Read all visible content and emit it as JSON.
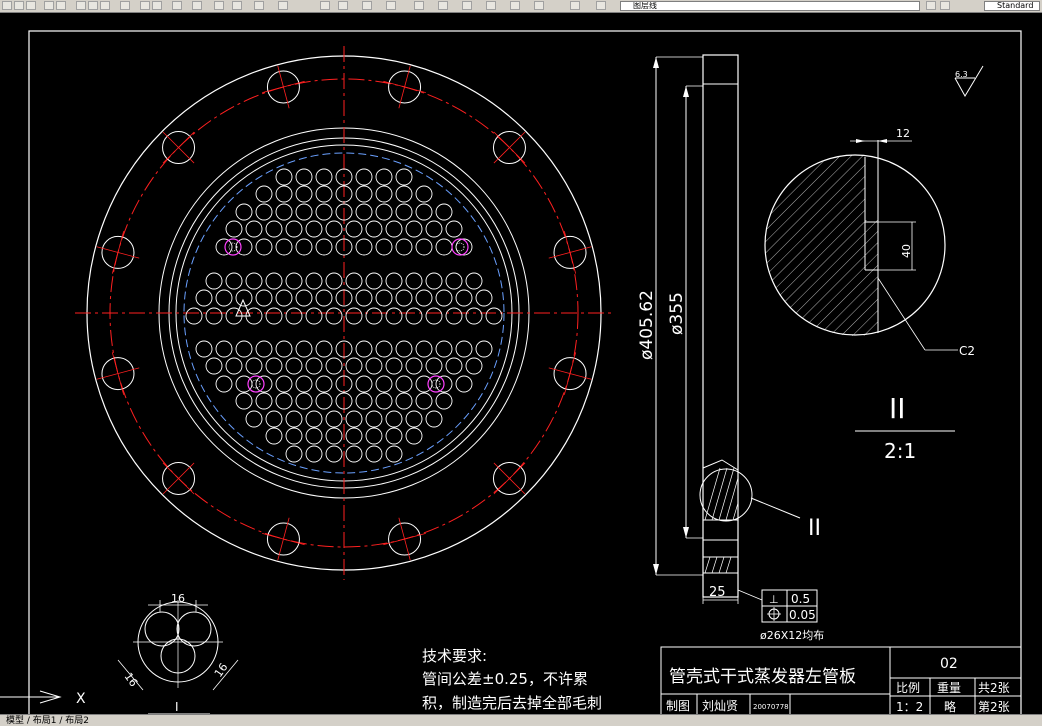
{
  "toolbar": {
    "layer_combo": "图层线",
    "font_combo": "Standard",
    "buttons": [
      "new",
      "open",
      "save",
      "print",
      "preview",
      "cut",
      "copy",
      "paste",
      "match",
      "undo",
      "redo",
      "pan",
      "zoom-realtime",
      "zoom-window",
      "zoom-previous",
      "properties",
      "designcenter",
      "tool-palettes",
      "markup",
      "calculator",
      "layer-properties"
    ]
  },
  "drawing": {
    "dim_diameter_outer": "ø405.62",
    "dim_diameter_inner": "ø355",
    "dim_thickness": "25",
    "dim_12": "12",
    "dim_40": "40",
    "chamfer": "C2",
    "roughness": "6.3",
    "detail_label": "II",
    "detail_scale": "2:1",
    "detail_callout": "II",
    "tol_perp": "0.5",
    "tol_pos": "0.05",
    "hole_note": "ø26X12均布",
    "view_label": "I",
    "dim_16_top": "16",
    "dim_16_left": "16",
    "dim_16_right": "16",
    "ucs_x": "X"
  },
  "tech_req": {
    "title": "技术要求:",
    "line1": "管间公差±0.25，不许累",
    "line2": "积，制造完后去掉全部毛刺"
  },
  "title_block": {
    "part_name": "管壳式干式蒸发器左管板",
    "drawing_no": "02",
    "scale_label": "比例",
    "weight_label": "重量",
    "total_sheets": "共2张",
    "scale_value": "1：2",
    "weight_value": "略",
    "sheet_no": "第2张",
    "drawn_label": "制图",
    "drawn_by": "刘灿贤",
    "drawn_date": "20070778"
  },
  "status": {
    "tabs": "模型 / 布局1 / 布局2"
  }
}
